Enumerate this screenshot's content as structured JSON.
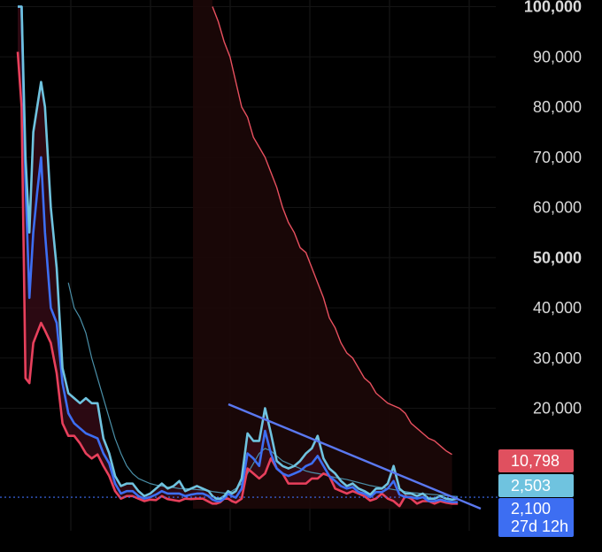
{
  "chart_data": {
    "type": "line",
    "y_axis": {
      "position": "right",
      "range": [
        0,
        100000
      ],
      "ticks": [
        "100,000",
        "90,000",
        "80,000",
        "70,000",
        "60,000",
        "50,000",
        "40,000",
        "30,000",
        "20,000"
      ],
      "tick_values": [
        100000,
        90000,
        80000,
        70000,
        60000,
        50000,
        40000,
        30000,
        20000
      ],
      "bold_ticks": [
        "100,000",
        "50,000"
      ]
    },
    "grid": true,
    "x": [
      0,
      2,
      4,
      6,
      8,
      10,
      12,
      14,
      17,
      20,
      23,
      26,
      29,
      32,
      35,
      38,
      41,
      44,
      47,
      50,
      53,
      56,
      59,
      62,
      65,
      68,
      71,
      74,
      77,
      80,
      83,
      86,
      89,
      92,
      95,
      98,
      100,
      102,
      104,
      106,
      108,
      110,
      112,
      115,
      118,
      121,
      124,
      127,
      130,
      133,
      136,
      139,
      142,
      145,
      148,
      151,
      154,
      157,
      160,
      163,
      166,
      169,
      172,
      175,
      178,
      181,
      184,
      187,
      190,
      193,
      196,
      199,
      202,
      205,
      208,
      211,
      214,
      217,
      220,
      223,
      226
    ],
    "series": [
      {
        "color": "#e8405c",
        "values": [
          91000,
          80000,
          26000,
          25000,
          33000,
          35000,
          37000,
          35500,
          33000,
          27000,
          17000,
          14500,
          14500,
          13000,
          11000,
          10000,
          10800,
          8500,
          6500,
          3500,
          2000,
          2500,
          2500,
          2000,
          1500,
          1800,
          1700,
          2500,
          1900,
          1700,
          1500,
          2000,
          1900,
          2000,
          2000,
          1400,
          1000,
          1000,
          1300,
          2000,
          2000,
          1500,
          1200,
          2000,
          8000,
          7000,
          6000,
          7000,
          10000,
          8000,
          7000,
          5000,
          5000,
          5000,
          5000,
          6000,
          6000,
          7000,
          6500,
          4000,
          3500,
          3000,
          3500,
          3000,
          2500,
          1600,
          2000,
          3000,
          2000,
          1500,
          500,
          2500,
          2000,
          1000,
          1500,
          1500,
          1000,
          1500,
          1200,
          1000,
          1000
        ]
      },
      {
        "color": "#6fc3df",
        "values": [
          100000,
          100000,
          70000,
          55000,
          75000,
          80000,
          85000,
          80000,
          60000,
          48000,
          28000,
          23000,
          22000,
          21000,
          22000,
          21000,
          21000,
          14000,
          11000,
          6500,
          4500,
          5000,
          5000,
          3500,
          2500,
          3000,
          4000,
          5000,
          4000,
          4500,
          5500,
          3500,
          4000,
          4500,
          4000,
          3500,
          2500,
          2000,
          2000,
          2500,
          3500,
          3000,
          3500,
          6000,
          15000,
          13500,
          13500,
          20000,
          15000,
          9500,
          8500,
          8000,
          8500,
          9500,
          11000,
          12000,
          14500,
          10000,
          8000,
          7000,
          5500,
          4500,
          5000,
          4000,
          3500,
          2800,
          4000,
          4000,
          5000,
          8500,
          4000,
          3000,
          3000,
          2500,
          3000,
          2000,
          2000,
          2500,
          2000,
          1800,
          2000
        ]
      },
      {
        "color": "#3d6ef2",
        "values": [
          100000,
          100000,
          65000,
          42000,
          55000,
          63000,
          70000,
          55000,
          40000,
          37000,
          25000,
          19000,
          17000,
          16000,
          15000,
          14500,
          14000,
          11000,
          9000,
          5000,
          3000,
          3500,
          3500,
          2500,
          2000,
          2300,
          2800,
          3500,
          3000,
          3000,
          3000,
          2500,
          2800,
          3000,
          3000,
          2500,
          1800,
          1500,
          1500,
          2000,
          3000,
          2500,
          2200,
          4000,
          11000,
          10000,
          8500,
          15500,
          11000,
          8000,
          7000,
          6500,
          7000,
          7500,
          8500,
          9000,
          10500,
          8500,
          6500,
          5500,
          4500,
          4000,
          4300,
          3300,
          3000,
          2300,
          3300,
          3300,
          4000,
          5500,
          2800,
          2300,
          2300,
          2000,
          2300,
          1500,
          1500,
          1800,
          1500,
          1300,
          1300
        ]
      },
      {
        "color": "#4a8fa8",
        "values": [
          null,
          null,
          null,
          null,
          null,
          null,
          null,
          null,
          null,
          null,
          null,
          45000,
          40000,
          38000,
          35000,
          30000,
          26000,
          22000,
          18000,
          14000,
          11000,
          8500,
          7000,
          6000,
          5500,
          5000,
          4700,
          4500,
          4300,
          4200,
          4000,
          4000,
          3900,
          3800,
          3700,
          3600,
          3400,
          3300,
          3200,
          3100,
          3200,
          3500,
          4000,
          5000,
          7000,
          9000,
          11000,
          12000,
          11500,
          10500,
          9500,
          9000,
          8500,
          8000,
          7500,
          7200,
          7000,
          6800,
          6500,
          6200,
          6000,
          5800,
          5500,
          5200,
          4900,
          4600,
          4400,
          4200,
          4000,
          3800,
          3600,
          3400,
          3200,
          3100,
          3000,
          2900,
          2800,
          2700,
          2600,
          2500,
          2400
        ]
      },
      {
        "color": "#f06070",
        "values": [
          null,
          null,
          null,
          null,
          null,
          null,
          null,
          null,
          null,
          null,
          null,
          null,
          null,
          null,
          null,
          null,
          null,
          null,
          null,
          null,
          null,
          null,
          null,
          null,
          null,
          null,
          null,
          null,
          null,
          null,
          null,
          null,
          null,
          null,
          null,
          null,
          null,
          null,
          null,
          null,
          null,
          null,
          null,
          null,
          null,
          null,
          null,
          null,
          null,
          null,
          null,
          null,
          null,
          null,
          null,
          null,
          null,
          null,
          null,
          null,
          null,
          null,
          null,
          null,
          null,
          null,
          null,
          null,
          null,
          null,
          null,
          null,
          null,
          null,
          null,
          null,
          null,
          null,
          null,
          null,
          null
        ]
      }
    ],
    "red_envelope": {
      "color": "#e8505f",
      "x": [
        100,
        103,
        106,
        109,
        112,
        115,
        118,
        121,
        124,
        127,
        130,
        133,
        136,
        139,
        142,
        145,
        148,
        151,
        154,
        157,
        160,
        163,
        166,
        169,
        172,
        175,
        178,
        181,
        184,
        187,
        190,
        193,
        196,
        199,
        202,
        205,
        208,
        211,
        214,
        217,
        220,
        223
      ],
      "values": [
        100000,
        97000,
        93000,
        90000,
        85000,
        80000,
        78000,
        74000,
        72000,
        70000,
        67000,
        64000,
        60000,
        57000,
        55000,
        52000,
        51000,
        48000,
        45000,
        42000,
        38000,
        36000,
        33000,
        31000,
        30000,
        28000,
        26000,
        25000,
        23000,
        22000,
        21000,
        20500,
        20000,
        19000,
        17000,
        16000,
        15000,
        14000,
        13500,
        12500,
        11500,
        10800
      ]
    },
    "shaded_region": {
      "x_start": 20,
      "x_end": 223,
      "color": "#1c0808"
    },
    "trendline": {
      "color": "#5a78f0",
      "x": [
        100,
        235
      ],
      "values": [
        20800,
        0
      ]
    },
    "current_price_line": {
      "value": 2100,
      "style": "dotted",
      "color": "#3d6ef2"
    },
    "price_labels": [
      {
        "text": "10,798",
        "color": "#e0505f"
      },
      {
        "text": "2,503",
        "color": "#6fc3df"
      },
      {
        "text": "2,100",
        "subtext": "27d 12h",
        "color": "#3d6ef2"
      }
    ]
  }
}
